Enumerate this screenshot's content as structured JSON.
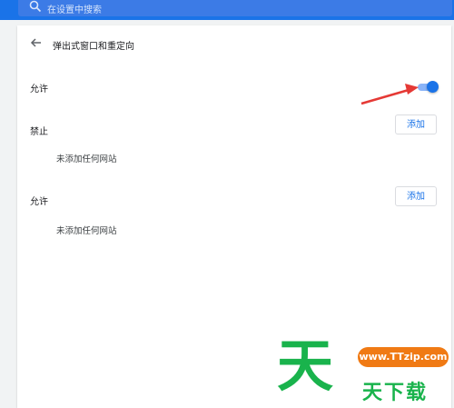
{
  "search": {
    "placeholder": "在设置中搜索"
  },
  "header": {
    "title": "弹出式窗口和重定向"
  },
  "allow_toggle": {
    "label": "允许",
    "enabled": true
  },
  "block_section": {
    "label": "禁止",
    "add_label": "添加",
    "empty_text": "未添加任何网站"
  },
  "allow_section": {
    "label": "允许",
    "add_label": "添加",
    "empty_text": "未添加任何网站"
  },
  "watermark": {
    "big_char": "天",
    "url": "www.TTzip.com",
    "sub_text": "天下载"
  },
  "colors": {
    "accent": "#1a73e8",
    "toggle_track": "#8ab4f8",
    "annotation_arrow": "#e53935",
    "watermark_green": "#19b34c",
    "watermark_orange": "#f07a14"
  }
}
